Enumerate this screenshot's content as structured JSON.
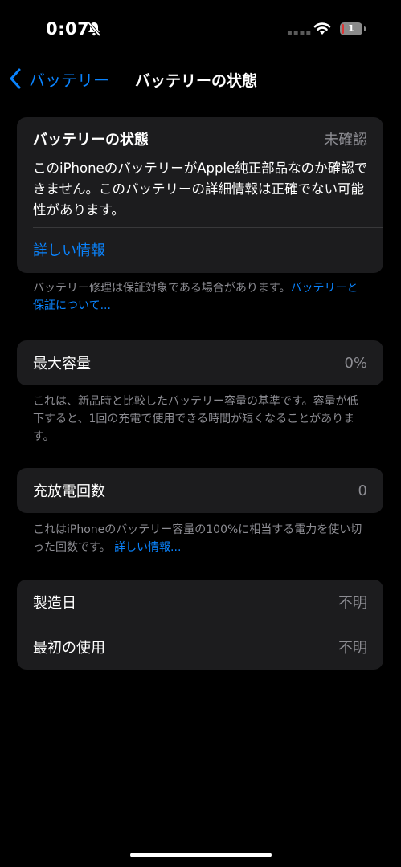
{
  "status_bar": {
    "time": "0:07",
    "battery_level": "1"
  },
  "nav": {
    "back_label": "バッテリー",
    "title": "バッテリーの状態"
  },
  "health_card": {
    "title": "バッテリーの状態",
    "status": "未確認",
    "description": "このiPhoneのバッテリーがApple純正部品なのか確認できません。このバッテリーの詳細情報は正確でない可能性があります。",
    "link": "詳しい情報"
  },
  "health_footer": {
    "text": "バッテリー修理は保証対象である場合があります。",
    "link": "バッテリーと保証について..."
  },
  "max_capacity": {
    "label": "最大容量",
    "value": "0%",
    "footer": "これは、新品時と比較したバッテリー容量の基準です。容量が低下すると、1回の充電で使用できる時間が短くなることがあります。"
  },
  "cycle_count": {
    "label": "充放電回数",
    "value": "0",
    "footer": "これはiPhoneのバッテリー容量の100%に相当する電力を使い切った回数です。",
    "link": "詳しい情報..."
  },
  "info_card": {
    "manufacture_label": "製造日",
    "manufacture_value": "不明",
    "first_use_label": "最初の使用",
    "first_use_value": "不明"
  },
  "colors": {
    "accent": "#0a84ff",
    "card": "#1c1c1e",
    "secondary_text": "#8d8d93",
    "background": "#000000"
  }
}
